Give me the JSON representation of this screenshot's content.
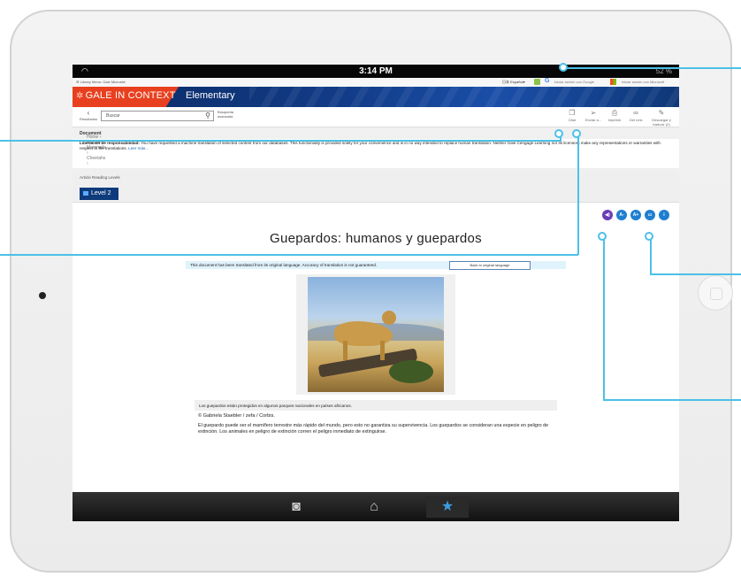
{
  "status": {
    "time": "3:14 PM",
    "battery": "52 %"
  },
  "util": {
    "menu": "☰ Library Menu: Gale Microsite",
    "lang": "日本 Español▾",
    "google_sign": "Iniciar sesión con Google",
    "ms_sign": "Iniciar sesión con Microsoft"
  },
  "banner": {
    "logo": "GALE IN CONTEXT",
    "level": "Elementary"
  },
  "toolbar": {
    "back": "Resultados",
    "search_placeholder": "Buscar",
    "advanced": "Búsqueda avanzada",
    "tools": [
      "Citar",
      "Enviar a...",
      "Imprimir",
      "Get Link",
      "Descargar y traducir (2)"
    ]
  },
  "breadcrumb": {
    "path": "Home › Animals › Mammals › Cheetahs › ",
    "current": "Document"
  },
  "disclaimer": {
    "label": "Liberación de responsabilidad:",
    "text": " You have requested a machine translation of selected content from our databases. This functionality is provided solely for your convenience and is in no way intended to replace human translation. Neither Gale Cengage Learning nor its licensors make any representations or warranties with respect to the translations. ",
    "more": "Leer más..."
  },
  "levels": {
    "label": "Article Reading Levels",
    "button": "Level 2"
  },
  "icons": [
    {
      "name": "speaker-icon",
      "glyph": "◀)"
    },
    {
      "name": "decrease-text-icon",
      "glyph": "A-"
    },
    {
      "name": "increase-text-icon",
      "glyph": "A+"
    },
    {
      "name": "dictionary-icon",
      "glyph": "▭"
    },
    {
      "name": "info-icon",
      "glyph": "i"
    }
  ],
  "document": {
    "title": "Guepardos: humanos y guepardos",
    "translation_notice": "This document has been translated from its original language. Accuracy of translation is not guaranteed.",
    "back_button": "Back to original language",
    "caption": "Los guepardos están protegidos en algunos parques nacionales en países africanos.",
    "credit": "© Gabriela Staebler / zefa / Corbis.",
    "body": "El guepardo puede ser el mamífero terrestre más rápido del mundo, pero esto no garantiza su supervivencia. Los guepardos se consideran una especie en peligro de extinción. Los animales en peligro de extinción corren el peligro inmediato de extinguirse."
  },
  "dock": {
    "camera": "camera-icon",
    "home": "home-icon",
    "favorites": "star-icon"
  },
  "colors": {
    "accent": "#4cc0e8",
    "brand_red": "#e8401f",
    "brand_blue": "#0e3b7c"
  }
}
